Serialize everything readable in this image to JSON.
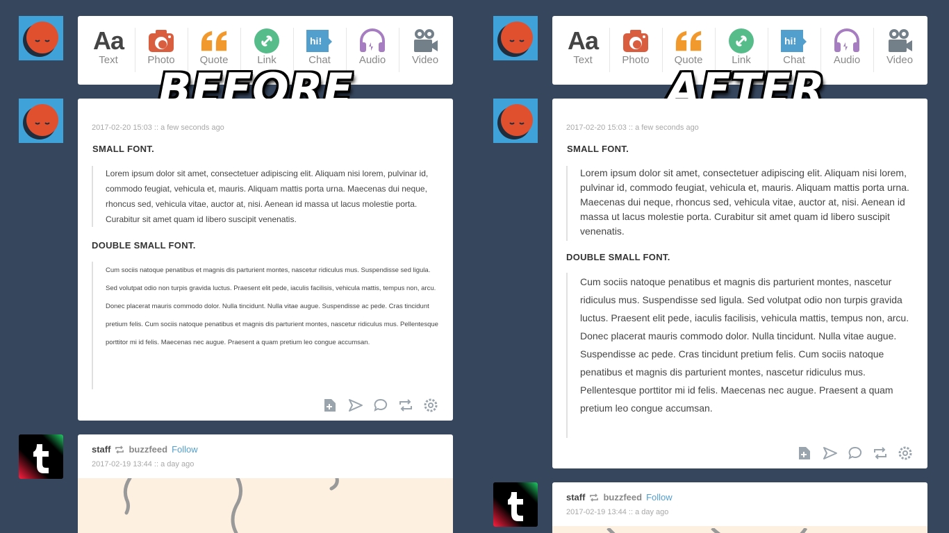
{
  "labels": {
    "before": "BEFORE",
    "after": "AFTER"
  },
  "post_types": [
    "Text",
    "Photo",
    "Quote",
    "Link",
    "Chat",
    "Audio",
    "Video"
  ],
  "post_type_icons": [
    "text-icon",
    "camera-icon",
    "quote-icon",
    "link-icon",
    "chat-icon",
    "headphones-icon",
    "video-camera-icon"
  ],
  "colors": {
    "background": "#36465d",
    "text": "#444444",
    "photo": "#d95e40",
    "quote": "#f2992e",
    "link": "#56bc8a",
    "chat": "#529ecc",
    "audio": "#a77dc2",
    "video": "#748089",
    "avatar_bg": "#3fa2d8",
    "follow": "#529ecc"
  },
  "text_post": {
    "meta": "2017-02-20 15:03 :: a few seconds ago",
    "heading1": "SMALL FONT.",
    "quote1": "Lorem ipsum dolor sit amet, consectetuer adipiscing elit. Aliquam nisi lorem, pulvinar id, commodo feugiat, vehicula et, mauris. Aliquam mattis porta urna. Maecenas dui neque, rhoncus sed, vehicula vitae, auctor at, nisi. Aenean id massa ut lacus molestie porta. Curabitur sit amet quam id libero suscipit venenatis.",
    "heading2": "DOUBLE SMALL FONT.",
    "quote2a": "Cum sociis natoque penatibus et magnis dis parturient montes, nascetur ridiculus mus. Suspendisse sed ligula. Sed volutpat odio non turpis gravida luctus. Praesent elit pede, iaculis facilisis, vehicula mattis, tempus non, arcu.",
    "quote2b": "Donec placerat mauris commodo dolor. Nulla tincidunt. Nulla vitae augue. Suspendisse ac pede. Cras tincidunt pretium felis. Cum sociis natoque penatibus et magnis dis parturient montes, nascetur ridiculus mus. Pellentesque porttitor mi id felis. Maecenas nec augue. Praesent a quam pretium leo congue accumsan."
  },
  "actions": [
    "add-to-queue-icon",
    "share-icon",
    "reply-icon",
    "reblog-icon",
    "settings-icon"
  ],
  "staff_post": {
    "blog": "staff",
    "reblogged_from": "buzzfeed",
    "follow": "Follow",
    "meta": "2017-02-19 13:44 :: a day ago"
  }
}
